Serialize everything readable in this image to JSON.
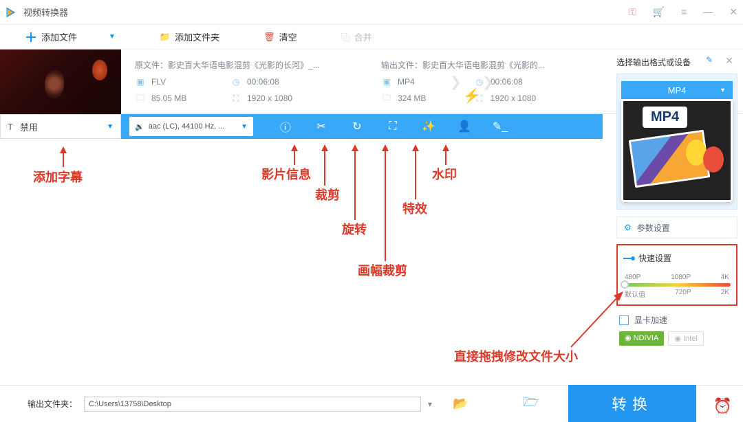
{
  "titlebar": {
    "title": "视频转换器"
  },
  "toolbar": {
    "add_file": "添加文件",
    "add_folder": "添加文件夹",
    "clear": "清空",
    "merge": "合并"
  },
  "source": {
    "label": "原文件：",
    "name": "影史百大华语电影混剪《光影的长河》_...",
    "format": "FLV",
    "duration": "00:06:08",
    "size": "85.05 MB",
    "resolution": "1920 x 1080"
  },
  "output": {
    "label": "输出文件：",
    "name": "影史百大华语电影混剪《光影的...",
    "format": "MP4",
    "duration": "00:06:08",
    "size": "324 MB",
    "resolution": "1920 x 1080"
  },
  "subtitle": {
    "value": "禁用"
  },
  "audio": {
    "value": "aac (LC), 44100 Hz, ..."
  },
  "right": {
    "select_label": "选择输出格式或设备",
    "format": "MP4",
    "preview_badge": "MP4",
    "param_settings": "参数设置",
    "quick_settings": "快速设置",
    "marks_top": [
      "480P",
      "1080P",
      "4K"
    ],
    "marks_bot": [
      "默认值",
      "720P",
      "2K"
    ],
    "gpu_accel": "显卡加速",
    "gpu_nvidia": "NDIVIA",
    "gpu_intel": "Intel"
  },
  "bottom": {
    "out_label": "输出文件夹：",
    "out_path": "C:\\Users\\13758\\Desktop",
    "convert": "转换"
  },
  "annotations": {
    "subtitle": "添加字幕",
    "info": "影片信息",
    "cut": "裁剪",
    "rotate": "旋转",
    "crop": "画幅裁剪",
    "effect": "特效",
    "watermark": "水印",
    "drag": "直接拖拽修改文件大小"
  }
}
